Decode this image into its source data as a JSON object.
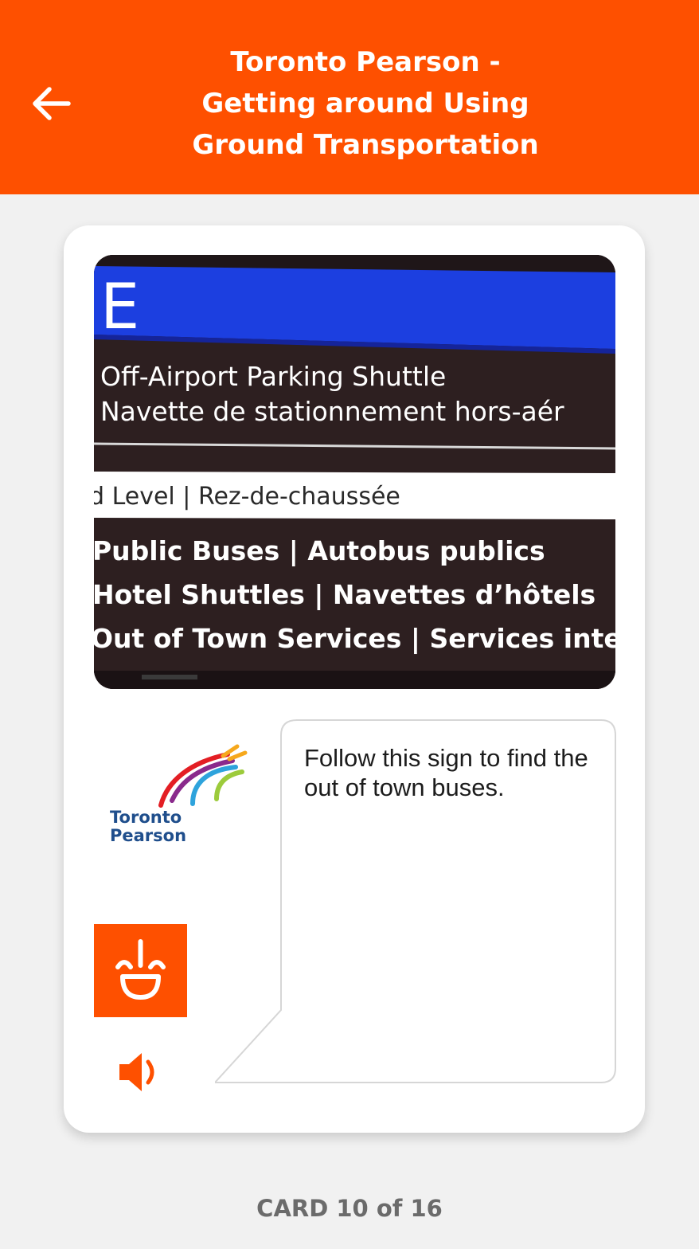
{
  "header": {
    "back_icon": "arrow-left-icon",
    "title_lines": [
      "Toronto Pearson -",
      "Getting around Using",
      "Ground Transportation"
    ]
  },
  "card": {
    "photo": {
      "sign_letter": "E",
      "lines": [
        "Off-Airport Parking Shuttle",
        "Navette de stationnement hors-aér",
        "d Level | Rez-de-chaussée",
        "Public Buses | Autobus publics",
        "Hotel Shuttles | Navettes d’hôtels",
        "Out of Town Services | Services inte"
      ]
    },
    "logo": {
      "line1": "Toronto",
      "line2": "Pearson"
    },
    "message": "Follow this sign to find the out of town buses.",
    "companion_icon": "smiling-face-icon",
    "speaker_icon": "speaker-icon"
  },
  "footer": {
    "counter": "CARD 10 of 16"
  },
  "colors": {
    "accent": "#fe5000",
    "background": "#f1f1f1",
    "card": "#ffffff",
    "sign_blue": "#1c3fe0",
    "sign_dark": "#2d1f20",
    "logo_blue": "#1f4e8c"
  }
}
